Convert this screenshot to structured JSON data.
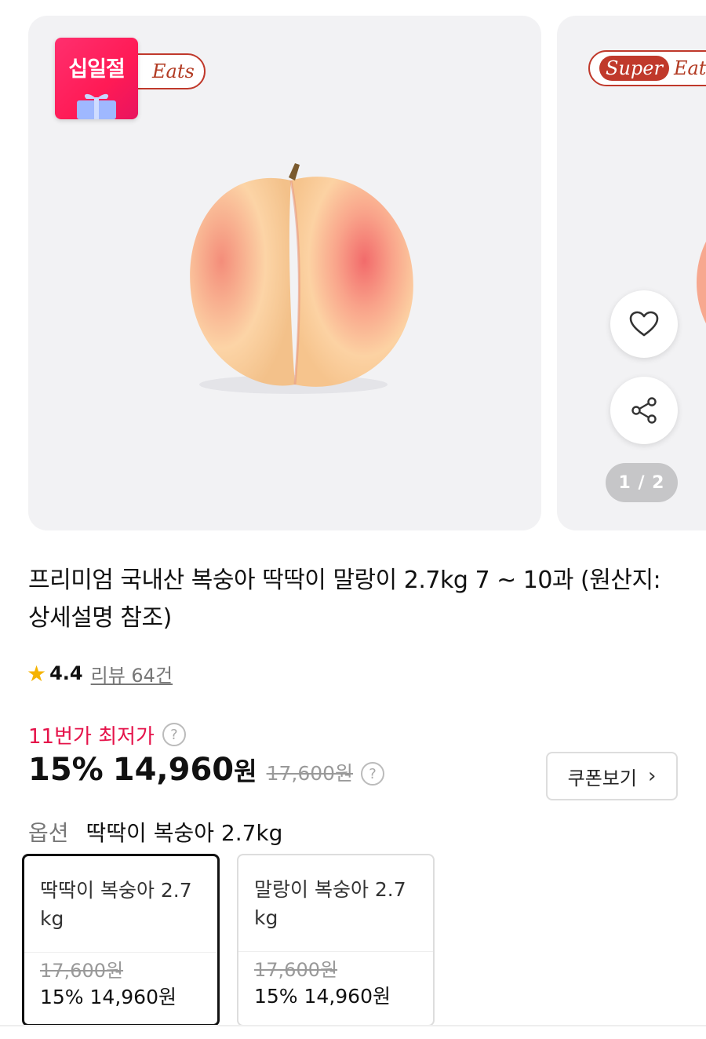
{
  "carousel": {
    "badge_text": "십일절",
    "brand": {
      "super": "Super",
      "eats": "Eats"
    },
    "page_indicator": "1 / 2",
    "colors": {
      "badge": "#ff1f5a",
      "brand": "#c0392b"
    },
    "icons": [
      "heart-icon",
      "share-icon",
      "gift-icon"
    ]
  },
  "product": {
    "title": "프리미엄 국내산 복숭아 딱딱이 말랑이 2.7kg 7 ~ 10과 (원산지: 상세설명 참조)",
    "rating": {
      "score": "4.4",
      "review_text": "리뷰 64건"
    },
    "lowest_label": "11번가 최저가",
    "price": {
      "discount": "15%",
      "amount": "14,960",
      "unit": "원",
      "original": "17,600원"
    },
    "coupon_label": "쿠폰보기"
  },
  "options": {
    "label": "옵션",
    "selected_value": "딱딱이 복숭아 2.7kg",
    "items": [
      {
        "name": "딱딱이 복숭아 2.7 kg",
        "original": "17,600원",
        "sale": "15% 14,960원",
        "selected": true
      },
      {
        "name": "말랑이 복숭아 2.7 kg",
        "original": "17,600원",
        "sale": "15% 14,960원",
        "selected": false
      }
    ]
  }
}
